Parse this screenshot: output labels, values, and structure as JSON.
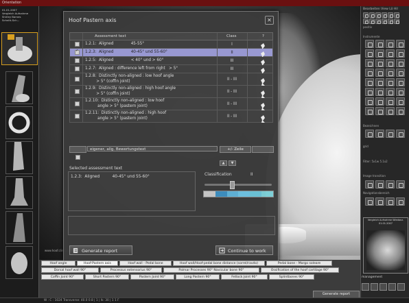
{
  "app": {
    "top_flag": "Orientation",
    "patient_info": [
      "01.01.2007",
      "Vergleich Aufnahme",
      "Shirley Barnes",
      "Schnitt-Sch..."
    ],
    "xray_hint": "www.hoof.clinic.de"
  },
  "dialog": {
    "title": "Hoof Pastern axis",
    "close_glyph": "✕",
    "columns": {
      "text": "Assessment text",
      "class": "Class",
      "help": "?"
    },
    "rows": [
      {
        "text": "1.2.1:  Aligned              45-55°",
        "class": "I",
        "checked": false,
        "selected": false
      },
      {
        "text": "1.2.3:  Aligned              40-45° und 55-60°",
        "class": "II",
        "checked": true,
        "selected": true
      },
      {
        "text": "1.2.5:  Aligned              < 40° und > 60°",
        "class": "III",
        "checked": false,
        "selected": false
      },
      {
        "text": "1.2.7:  Aligned : difference left from right   > 5°",
        "class": "III",
        "checked": false,
        "selected": false
      },
      {
        "text": "1.2.8:  Distinctly non-aligned : low hoof angle\n         > 5° (coffin joint)",
        "class": "II - III",
        "checked": false,
        "selected": false
      },
      {
        "text": "1.2.9:  Distinctly non-aligned : high hoof angle\n         > 5° (coffin joint)",
        "class": "II - III",
        "checked": false,
        "selected": false
      },
      {
        "text": "1.2.10:  Distinctly non-aligned : low hoof\n          angle > 5° (pastern joint)",
        "class": "II - III",
        "checked": false,
        "selected": false
      },
      {
        "text": "1.2.11:  Distinctly non-aligned : high hoof\n          angle > 5° (pastern joint)",
        "class": "II - III",
        "checked": false,
        "selected": false
      }
    ],
    "custom_text": "eigener, allg. Bewertungstext",
    "add_row_label": "+/- Zeile",
    "arrow_up": "▲",
    "arrow_down": "▼",
    "selected_title": "Selected assessment text",
    "selected_text": "1.2.3:  Aligned          40-45° und 55-60°",
    "classification_label": "Classification",
    "classification_value": "II",
    "classification_level": 0.4,
    "scale_colors": [
      "#c8c8c8",
      "#3d8fc0",
      "#5fb3d8",
      "#6ec2e2",
      "#6cc4d8",
      "#7cd0d8"
    ],
    "generate_label": "Generate report",
    "continue_label": "Continue to work"
  },
  "right_panel": {
    "top_label": "Bearbeiten  View  Lö  Hil",
    "sections": [
      "positiv",
      "Instrumente",
      "Bezeichnen",
      "grid",
      "Filter: 5x1w 5.1x2",
      "Image transition",
      "Navigationsbereich",
      "management"
    ],
    "thumb_caption": "Vergleich Aufnahme  Wiedanz. 01.01.2007"
  },
  "tabs": {
    "row1": [
      "Hoof angle",
      "Hoof-Pastern axis",
      "Hoof wall - Pedal bone",
      "Hoof wall/Hoof-pedal bone distance (sorrel/ravdo)",
      "Pedal bone - Margo soleare"
    ],
    "row2": [
      "Dorsal hoof wall 90°",
      "Processus extensorius 90°",
      "Palmar Processes 90° Navicular bone 90°",
      "Ossification of the hoof cartilage 90°"
    ],
    "row3": [
      "Coffin Joint 90°",
      "Short Pastern 90°",
      "Pastern Joint 90°",
      "Long Pastern 90°",
      "Fetlock Joint 90°",
      "Splintbones 90°"
    ],
    "generate_report": "Generate report"
  },
  "status": "W : C : 1024 Transverse: 40.0 0.8  | 1  |  lk: 30  |  1 1 F"
}
